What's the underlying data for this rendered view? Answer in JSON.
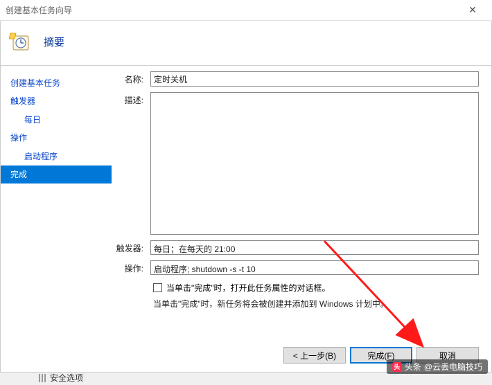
{
  "window": {
    "title": "创建基本任务向导"
  },
  "header": {
    "title": "摘要"
  },
  "sidebar": {
    "items": [
      {
        "label": "创建基本任务",
        "sub": false
      },
      {
        "label": "触发器",
        "sub": false
      },
      {
        "label": "每日",
        "sub": true
      },
      {
        "label": "操作",
        "sub": false
      },
      {
        "label": "启动程序",
        "sub": true
      },
      {
        "label": "完成",
        "sub": false,
        "selected": true
      }
    ]
  },
  "form": {
    "name_label": "名称:",
    "name_value": "定时关机",
    "desc_label": "描述:",
    "desc_value": "",
    "trigger_label": "触发器:",
    "trigger_value": "每日；在每天的 21:00",
    "action_label": "操作:",
    "action_value": "启动程序; shutdown -s -t 10",
    "checkbox_label": "当单击\"完成\"时，打开此任务属性的对话框。",
    "hint": "当单击\"完成\"时，新任务将会被创建并添加到 Windows 计划中。"
  },
  "buttons": {
    "back": "< 上一步(B)",
    "finish": "完成(F)",
    "cancel": "取消"
  },
  "watermark": {
    "prefix": "头条",
    "text": "@云丢电脑技巧"
  },
  "peek": {
    "label": "安全选项"
  }
}
